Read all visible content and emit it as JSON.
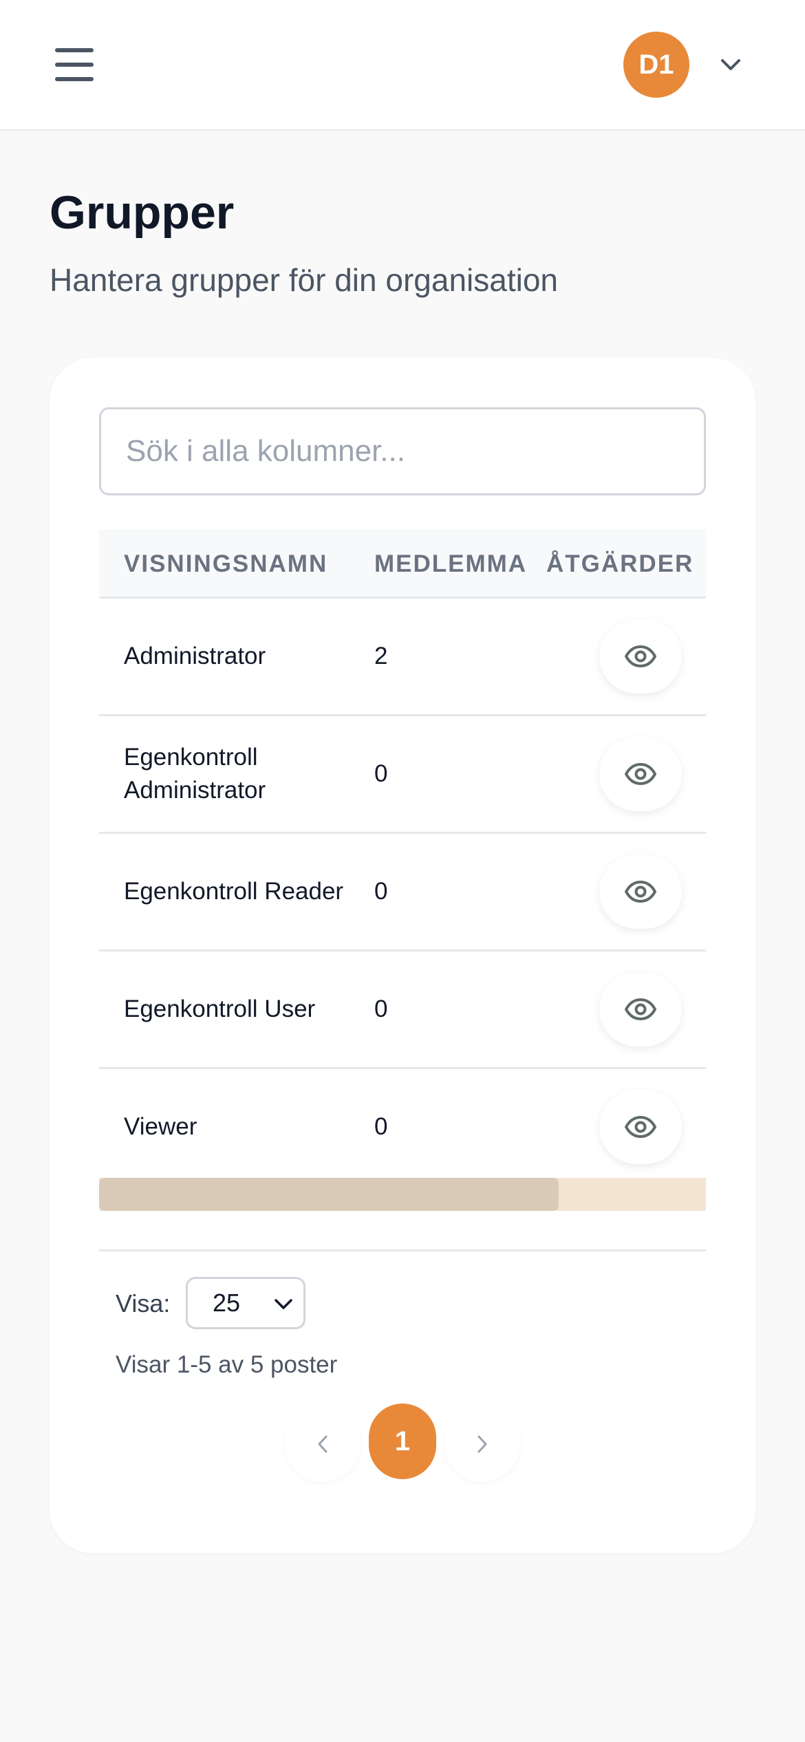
{
  "header": {
    "avatar_initials": "D1",
    "accent_color": "#e8893a"
  },
  "page": {
    "title": "Grupper",
    "subtitle": "Hantera grupper för din organisation"
  },
  "search": {
    "placeholder": "Sök i alla kolumner...",
    "value": ""
  },
  "table": {
    "columns": [
      "VISNINGSNAMN",
      "MEDLEMMA",
      "ÅTGÄRDER"
    ],
    "rows": [
      {
        "name": "Administrator",
        "members": "2",
        "action_icon": "eye-icon"
      },
      {
        "name": "Egenkontroll Administrator",
        "members": "0",
        "action_icon": "eye-icon"
      },
      {
        "name": "Egenkontroll Reader",
        "members": "0",
        "action_icon": "eye-icon"
      },
      {
        "name": "Egenkontroll User",
        "members": "0",
        "action_icon": "eye-icon"
      },
      {
        "name": "Viewer",
        "members": "0",
        "action_icon": "eye-icon"
      }
    ]
  },
  "pagination": {
    "page_size_label": "Visa:",
    "page_size": "25",
    "summary": "Visar 1-5 av 5 poster",
    "current_page": "1"
  }
}
